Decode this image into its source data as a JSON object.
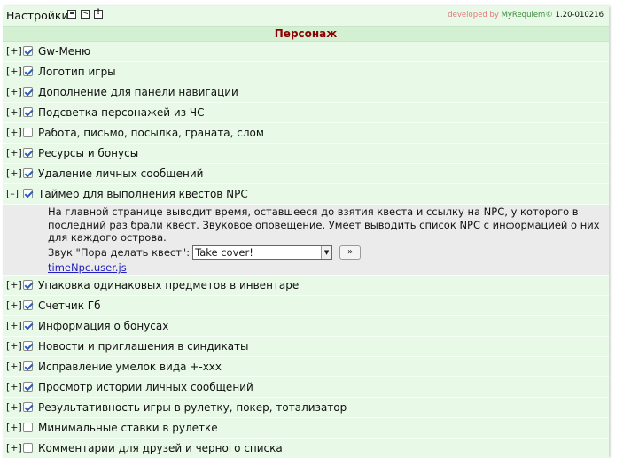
{
  "header": {
    "settings_label": "Настройки:",
    "icons": [
      "save-icon",
      "mail-icon",
      "info-icon"
    ],
    "credits": {
      "developed_by": "developed by",
      "author": "MyRequiem©",
      "version": "1.20-010216"
    }
  },
  "section": {
    "title": "Персонаж"
  },
  "items": [
    {
      "toggle": "[+]",
      "checked": true,
      "label": "Gw-Меню"
    },
    {
      "toggle": "[+]",
      "checked": true,
      "label": "Логотип игры"
    },
    {
      "toggle": "[+]",
      "checked": true,
      "label": "Дополнение для панели навигации"
    },
    {
      "toggle": "[+]",
      "checked": true,
      "label": "Подсветка персонажей из ЧС"
    },
    {
      "toggle": "[+]",
      "checked": false,
      "label": "Работа, письмо, посылка, граната, слом"
    },
    {
      "toggle": "[+]",
      "checked": true,
      "label": "Ресурсы и бонусы"
    },
    {
      "toggle": "[+]",
      "checked": true,
      "label": "Удаление личных сообщений"
    },
    {
      "toggle": "[–]",
      "checked": true,
      "label": "Таймер для выполнения квестов NPC"
    },
    {
      "toggle": "[+]",
      "checked": true,
      "label": "Упаковка одинаковых предметов в инвентаре"
    },
    {
      "toggle": "[+]",
      "checked": true,
      "label": "Счетчик Гб"
    },
    {
      "toggle": "[+]",
      "checked": true,
      "label": "Информация о бонусах"
    },
    {
      "toggle": "[+]",
      "checked": true,
      "label": "Новости и приглашения в синдикаты"
    },
    {
      "toggle": "[+]",
      "checked": true,
      "label": "Исправление умелок вида +-ххх"
    },
    {
      "toggle": "[+]",
      "checked": true,
      "label": "Просмотр истории личных сообщений"
    },
    {
      "toggle": "[+]",
      "checked": true,
      "label": "Результативность игры в рулетку, покер, тотализатор"
    },
    {
      "toggle": "[+]",
      "checked": false,
      "label": "Минимальные ставки в рулетке"
    },
    {
      "toggle": "[+]",
      "checked": false,
      "label": "Комментарии для друзей и черного списка"
    }
  ],
  "expanded": {
    "after_index": 7,
    "description": "На главной странице выводит время, оставшееся до взятия квеста и ссылку на NPC, у которого в последний раз брали квест. Звуковое оповещение. Умеет выводить список NPC с информацией о них для каждого острова.",
    "sound_label": "Звук \"Пора делать квест\":",
    "sound_value": "Take cover!",
    "play_label": "»",
    "link_text": "timeNpc.user.js"
  }
}
